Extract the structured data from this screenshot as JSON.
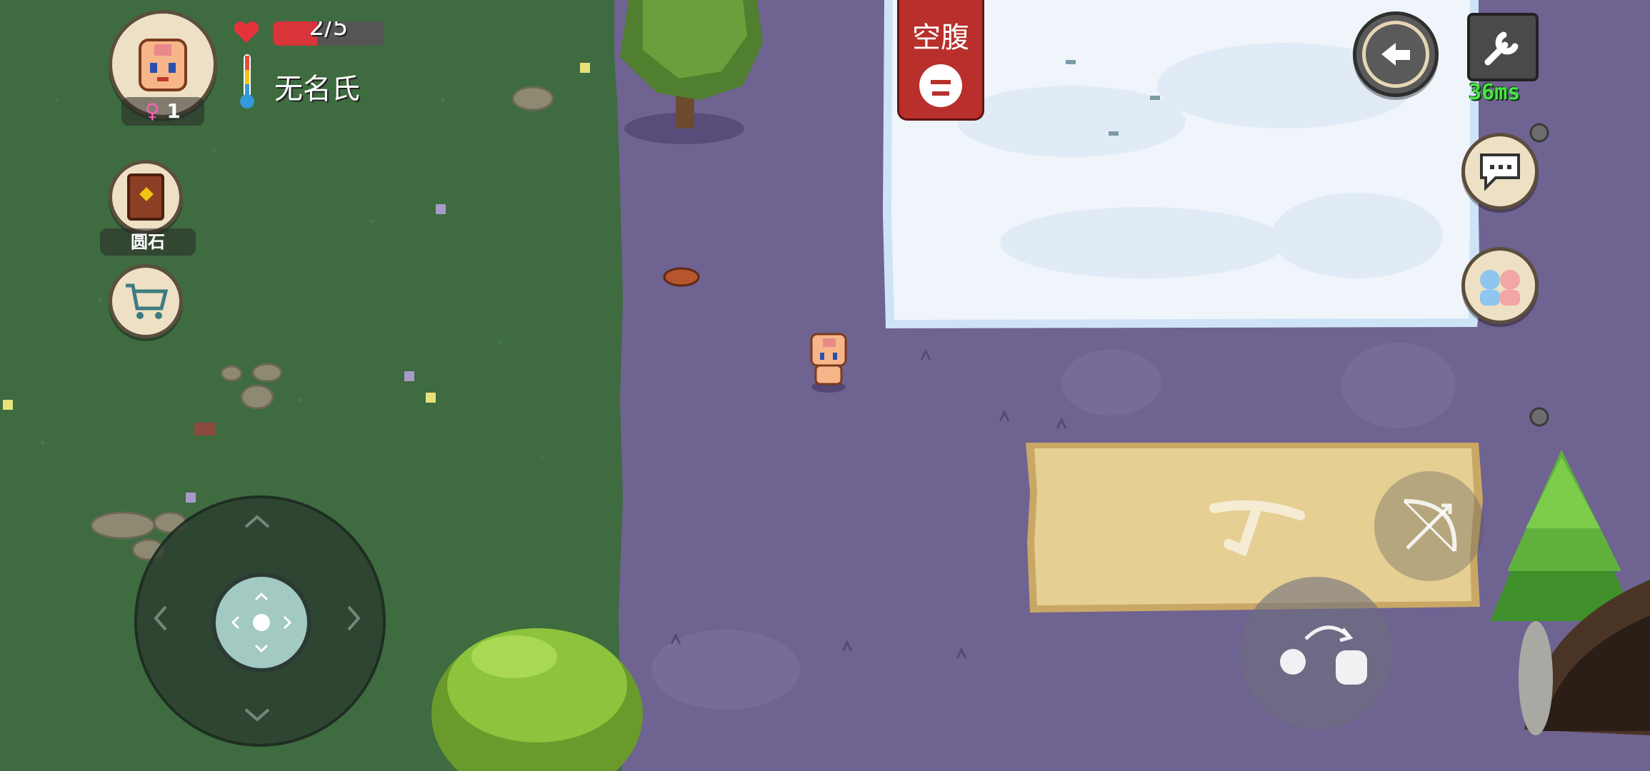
{
  "player": {
    "health_text": "2/5",
    "health_fraction": 0.4,
    "name": "无名氏",
    "gender_symbol": "♀",
    "level": "1"
  },
  "status_tag": {
    "label": "空腹"
  },
  "ping": {
    "text": "36ms"
  },
  "inventory": [
    {
      "label": "圆石",
      "icon": "book-icon"
    },
    {
      "label": "",
      "icon": "shopping-cart-icon"
    }
  ],
  "icons": {
    "heart": "heart-icon",
    "thermometer": "thermometer-icon",
    "back": "back-arrow-icon",
    "settings": "wrench-icon",
    "chat": "chat-bubble-icon",
    "friends": "friends-icon",
    "bow": "bow-icon",
    "throw": "throw-icon"
  },
  "colors": {
    "health": "#d8343a",
    "tag_red": "#b82f2b",
    "ping_green": "#4de34a"
  }
}
